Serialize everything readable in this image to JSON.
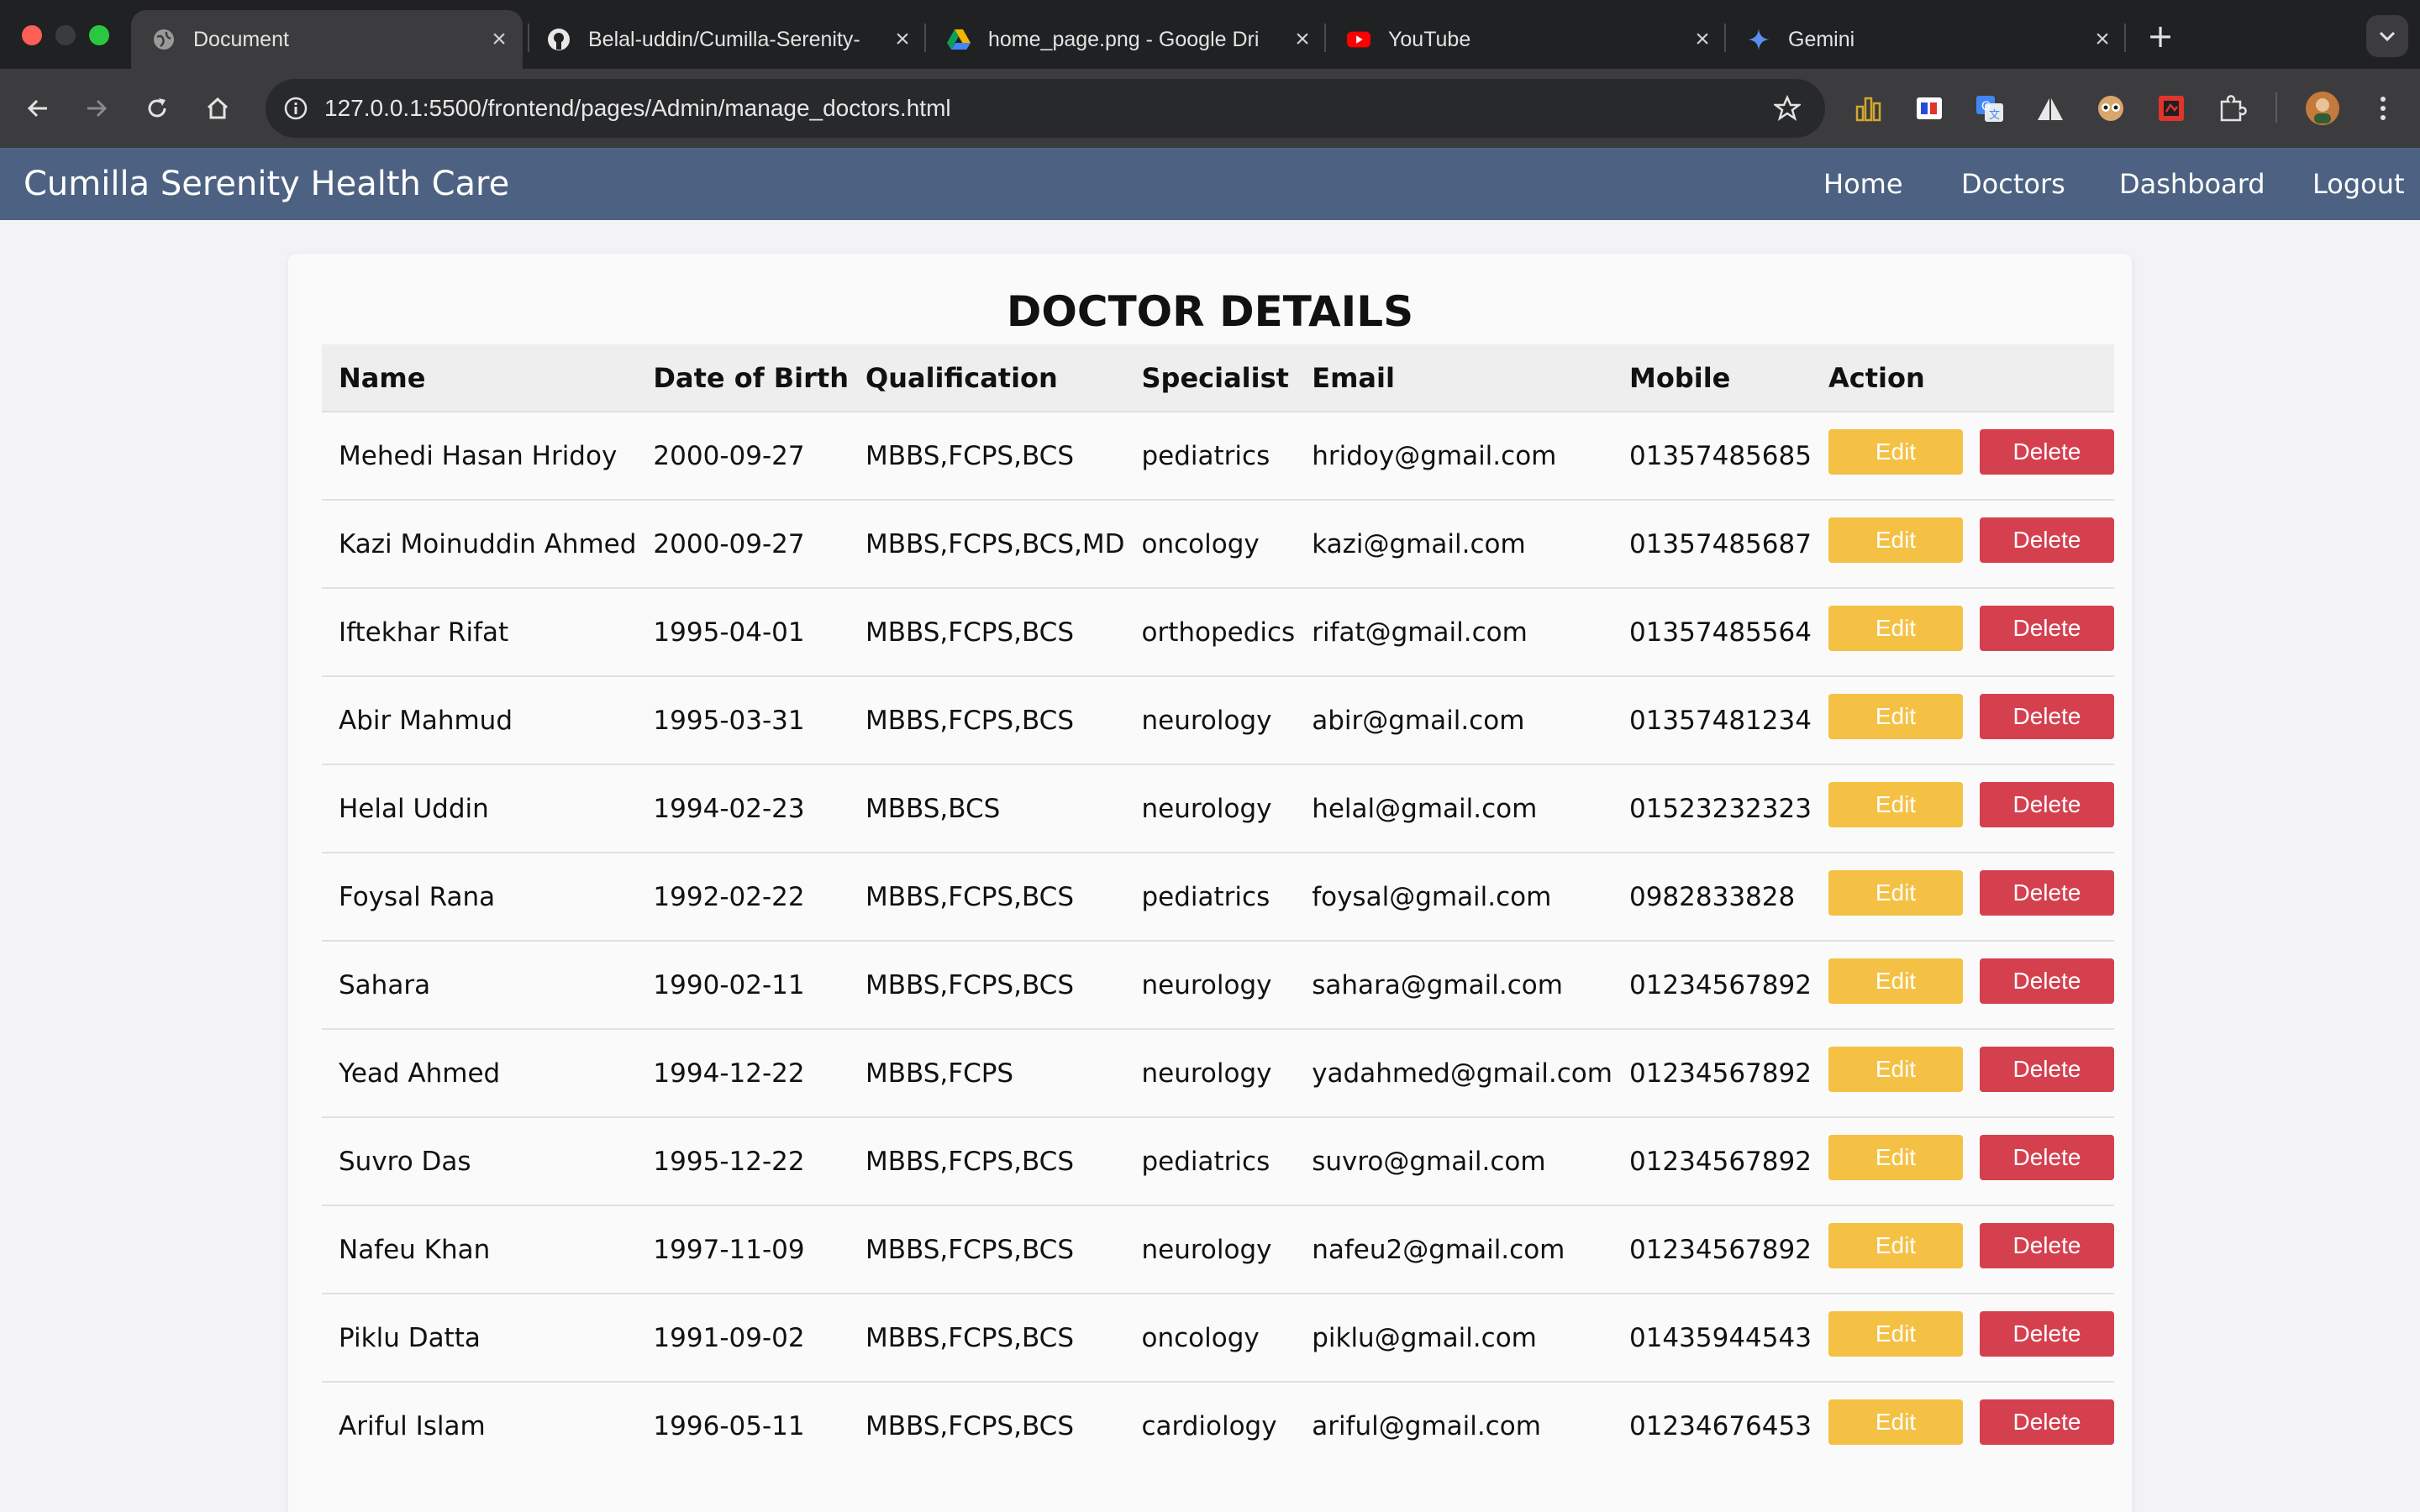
{
  "browser": {
    "tabs": [
      {
        "label": "Document",
        "icon": "globe-icon",
        "active": true
      },
      {
        "label": "Belal-uddin/Cumilla-Serenity-",
        "icon": "github-icon",
        "active": false
      },
      {
        "label": "home_page.png - Google Dri",
        "icon": "google-drive-icon",
        "active": false
      },
      {
        "label": "YouTube",
        "icon": "youtube-icon",
        "active": false
      },
      {
        "label": "Gemini",
        "icon": "gemini-icon",
        "active": false
      }
    ],
    "url": "127.0.0.1:5500/frontend/pages/Admin/manage_doctors.html"
  },
  "header": {
    "brand": "Cumilla Serenity Health Care",
    "nav": [
      "Home",
      "Doctors",
      "Dashboard",
      "Logout"
    ]
  },
  "page": {
    "title": "DOCTOR DETAILS",
    "columns": [
      "Name",
      "Date of Birth",
      "Qualification",
      "Specialist",
      "Email",
      "Mobile",
      "Action"
    ],
    "edit_label": "Edit",
    "delete_label": "Delete",
    "rows": [
      [
        "Mehedi Hasan Hridoy",
        "2000-09-27",
        "MBBS,FCPS,BCS",
        "pediatrics",
        "hridoy@gmail.com",
        "01357485685"
      ],
      [
        "Kazi Moinuddin Ahmed",
        "2000-09-27",
        "MBBS,FCPS,BCS,MD",
        "oncology",
        "kazi@gmail.com",
        "01357485687"
      ],
      [
        "Iftekhar Rifat",
        "1995-04-01",
        "MBBS,FCPS,BCS",
        "orthopedics",
        "rifat@gmail.com",
        "01357485564"
      ],
      [
        "Abir Mahmud",
        "1995-03-31",
        "MBBS,FCPS,BCS",
        "neurology",
        "abir@gmail.com",
        "01357481234"
      ],
      [
        "Helal Uddin",
        "1994-02-23",
        "MBBS,BCS",
        "neurology",
        "helal@gmail.com",
        "01523232323"
      ],
      [
        "Foysal Rana",
        "1992-02-22",
        "MBBS,FCPS,BCS",
        "pediatrics",
        "foysal@gmail.com",
        "0982833828"
      ],
      [
        "Sahara",
        "1990-02-11",
        "MBBS,FCPS,BCS",
        "neurology",
        "sahara@gmail.com",
        "01234567892"
      ],
      [
        "Yead Ahmed",
        "1994-12-22",
        "MBBS,FCPS",
        "neurology",
        "yadahmed@gmail.com",
        "01234567892"
      ],
      [
        "Suvro Das",
        "1995-12-22",
        "MBBS,FCPS,BCS",
        "pediatrics",
        "suvro@gmail.com",
        "01234567892"
      ],
      [
        "Nafeu Khan",
        "1997-11-09",
        "MBBS,FCPS,BCS",
        "neurology",
        "nafeu2@gmail.com",
        "01234567892"
      ],
      [
        "Piklu Datta",
        "1991-09-02",
        "MBBS,FCPS,BCS",
        "oncology",
        "piklu@gmail.com",
        "01435944543"
      ],
      [
        "Ariful Islam",
        "1996-05-11",
        "MBBS,FCPS,BCS",
        "cardiology",
        "ariful@gmail.com",
        "01234676453"
      ]
    ]
  },
  "colors": {
    "header_bg": "#4d6282",
    "edit_bg": "#f4c144",
    "delete_bg": "#d5404f",
    "page_bg": "#f3f3f5"
  }
}
